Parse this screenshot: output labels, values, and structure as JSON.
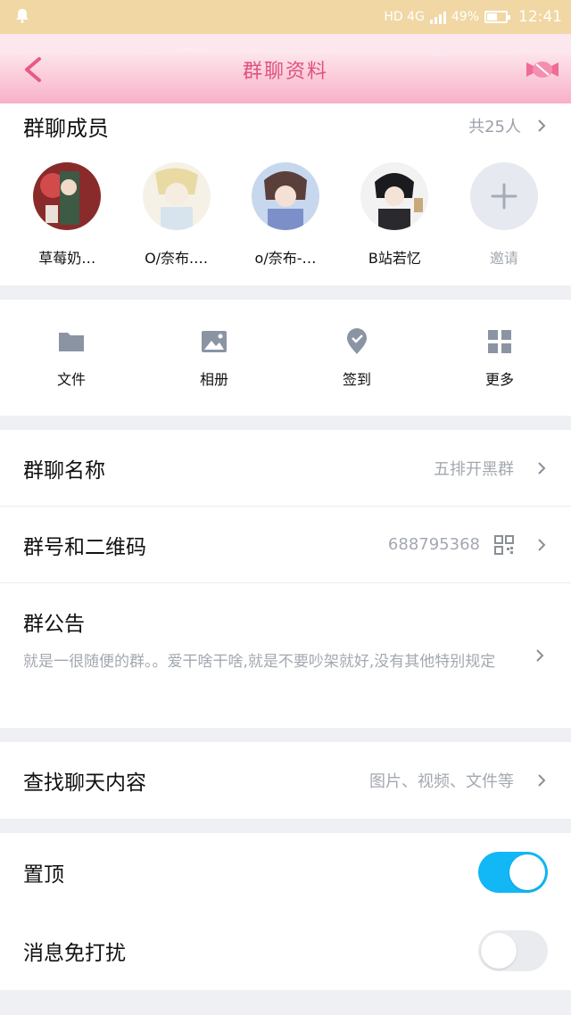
{
  "status_bar": {
    "network": "HD 4G",
    "battery": "49%",
    "battery_level": 0.49,
    "time": "12:41"
  },
  "header": {
    "title": "群聊资料"
  },
  "members": {
    "title": "群聊成员",
    "count": "共25人",
    "list": [
      {
        "name": "草莓奶…"
      },
      {
        "name": "O/奈布.…"
      },
      {
        "name": "o/奈布-…"
      },
      {
        "name": "B站若忆"
      }
    ],
    "invite_label": "邀请"
  },
  "tools": [
    {
      "label": "文件",
      "icon": "folder-icon"
    },
    {
      "label": "相册",
      "icon": "image-icon"
    },
    {
      "label": "签到",
      "icon": "check-pin-icon"
    },
    {
      "label": "更多",
      "icon": "grid-icon"
    }
  ],
  "group_name": {
    "label": "群聊名称",
    "value": "五排开黑群"
  },
  "group_number": {
    "label": "群号和二维码",
    "value": "688795368"
  },
  "notice": {
    "label": "群公告",
    "text": "就是一很随便的群。。爱干啥干啥,就是不要吵架就好,没有其他特别规定"
  },
  "search": {
    "label": "查找聊天内容",
    "value": "图片、视频、文件等"
  },
  "pin_top": {
    "label": "置顶",
    "on": true
  },
  "do_not_disturb": {
    "label": "消息免打扰",
    "on": false
  }
}
